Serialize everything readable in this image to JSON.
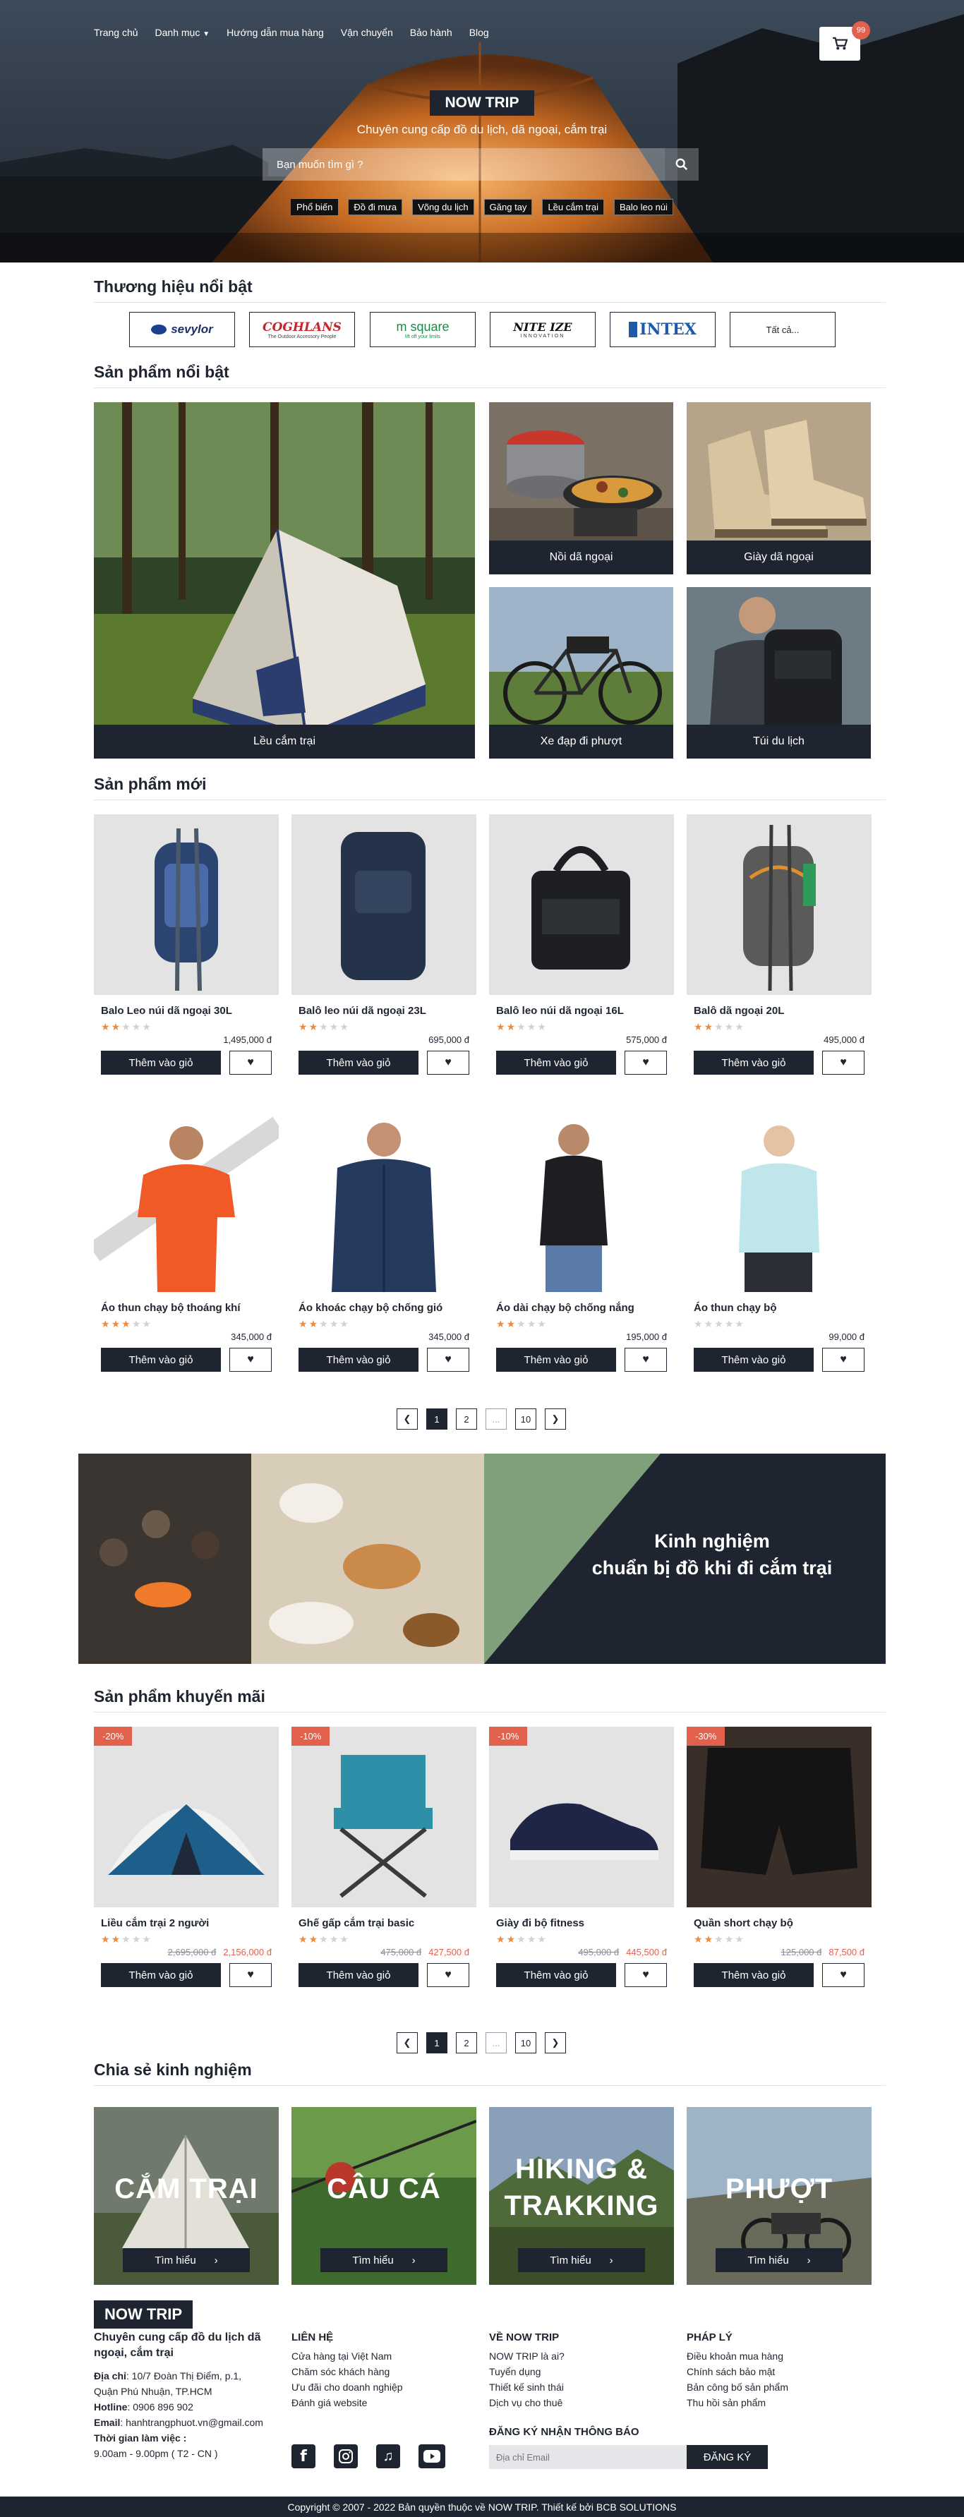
{
  "nav": {
    "items": [
      "Trang chủ",
      "Danh mục",
      "Hướng dẫn mua hàng",
      "Vận chuyển",
      "Bảo hành",
      "Blog"
    ]
  },
  "cart": {
    "count": "99"
  },
  "hero": {
    "brand": "NOW TRIP",
    "tagline": "Chuyên cung cấp đồ du lịch, dã ngoại, cắm trại",
    "search_placeholder": "Bạn muốn tìm gì ?",
    "chips": [
      "Phổ biến",
      "Đồ đi mưa",
      "Võng du lịch",
      "Găng tay",
      "Lều cắm trại",
      "Balo leo núi"
    ]
  },
  "brands": {
    "title": "Thương hiệu nổi bật",
    "items": [
      "sevylor",
      "COGHLANS",
      "m square",
      "NITE IZE",
      "INTEX"
    ],
    "coghlans_sub": "The Outdoor Accessory People",
    "msquare_sub": "lift off your limits",
    "niteize_sub": "INNOVATION",
    "all": "Tất cả..."
  },
  "featured": {
    "title": "Sản phẩm nổi bật",
    "tiles": [
      "Lều cắm trại",
      "Nồi dã ngoại",
      "Giày dã ngoại",
      "Xe đạp đi phượt",
      "Túi du lịch"
    ]
  },
  "new_products": {
    "title": "Sản phẩm mới",
    "add_label": "Thêm vào giỏ",
    "items": [
      {
        "name": "Balo Leo núi dã ngoại 30L",
        "price": "1,495,000 đ",
        "rating": 2
      },
      {
        "name": "Balô leo núi dã ngoại 23L",
        "price": "695,000 đ",
        "rating": 2
      },
      {
        "name": "Balô leo núi dã ngoại 16L",
        "price": "575,000 đ",
        "rating": 2
      },
      {
        "name": "Balô dã ngoại 20L",
        "price": "495,000 đ",
        "rating": 2
      },
      {
        "name": "Áo thun chạy bộ thoáng khí",
        "price": "345,000 đ",
        "rating": 3
      },
      {
        "name": "Áo khoác chạy bộ chống gió",
        "price": "345,000 đ",
        "rating": 2
      },
      {
        "name": "Áo dài chạy bộ chống nắng",
        "price": "195,000 đ",
        "rating": 2
      },
      {
        "name": "Áo thun chạy bộ",
        "price": "99,000 đ",
        "rating": 0
      }
    ]
  },
  "pagination": {
    "current": "1",
    "p2": "2",
    "dots": "...",
    "last": "10"
  },
  "banner": {
    "line1": "Kinh nghiệm",
    "line2": "chuẩn bị đồ khi đi cắm trại"
  },
  "sale": {
    "title": "Sản phẩm khuyến mãi",
    "items": [
      {
        "badge": "-20%",
        "name": "Liều cắm trại 2 người",
        "old": "2,695,000 đ",
        "new": "2,156,000 đ",
        "rating": 2
      },
      {
        "badge": "-10%",
        "name": "Ghế gấp cắm trại basic",
        "old": "475,000 đ",
        "new": "427,500 đ",
        "rating": 2
      },
      {
        "badge": "-10%",
        "name": "Giày đi bộ fitness",
        "old": "495,000 đ",
        "new": "445,500 đ",
        "rating": 2
      },
      {
        "badge": "-30%",
        "name": "Quần short chạy bộ",
        "old": "125,000 đ",
        "new": "87,500 đ",
        "rating": 2
      }
    ]
  },
  "experience": {
    "title": "Chia sẻ kinh nghiệm",
    "more": "Tìm hiểu",
    "items": [
      "CẮM TRẠI",
      "CÂU CÁ",
      "HIKING &\nTRAKKING",
      "PHƯỢT"
    ]
  },
  "footer": {
    "logo": "NOW TRIP",
    "slogan": "Chuyên cung cấp đồ du lịch dã ngoại, cắm trại",
    "address_label": "Địa chỉ",
    "address": ": 10/7 Đoàn Thị Điểm, p.1, Quận Phú Nhuận, TP.HCM",
    "hotline_label": "Hotline",
    "hotline": ": 0906 896 902",
    "email_label": "Email",
    "email": ": hanhtrangphuot.vn@gmail.com",
    "hours_label": "Thời gian làm việc :",
    "hours": "9.00am - 9.00pm ( T2 - CN )",
    "contact": {
      "title": "LIÊN HỆ",
      "items": [
        "Cửa hàng tại Việt Nam",
        "Chăm sóc khách hàng",
        "Ưu đãi cho doanh nghiệp",
        "Đánh giá website"
      ]
    },
    "about": {
      "title": "VỀ NOW TRIP",
      "items": [
        "NOW TRIP là ai?",
        "Tuyển dụng",
        "Thiết kế sinh thái",
        "Dịch vụ cho thuê"
      ]
    },
    "legal": {
      "title": "PHÁP LÝ",
      "items": [
        "Điều khoản mua hàng",
        "Chính sách bảo mật",
        "Bản công bố sản phẩm",
        "Thu hồi sản phẩm"
      ]
    },
    "subscribe_title": "ĐĂNG KÝ NHẬN THÔNG BÁO",
    "subscribe_placeholder": "Địa chỉ Email",
    "subscribe_btn": "ĐĂNG KÝ",
    "copyright": "Copyright © 2007 - 2022 Bản quyền thuộc về NOW TRIP. Thiết kế bởi BCB SOLUTIONS"
  }
}
